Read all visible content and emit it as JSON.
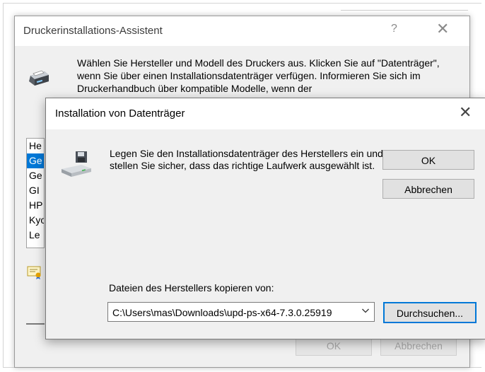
{
  "wizard": {
    "title": "Druckerinstallations-Assistent",
    "help_glyph": "?",
    "close_glyph": "✕",
    "description": "Wählen Sie Hersteller und Modell des Druckers aus. Klicken Sie auf \"Datenträger\", wenn Sie über einen Installationsdatenträger verfügen. Informieren Sie sich im Druckerhandbuch über kompatible Modelle, wenn der",
    "manufacturers": [
      "He",
      "Ge",
      "Ge",
      "GI",
      "HP",
      "Kyo",
      "Le"
    ],
    "selected_index": 1,
    "ok_label": "OK",
    "cancel_label": "Abbrechen"
  },
  "dialog": {
    "title": "Installation von Datenträger",
    "close_glyph": "✕",
    "message": "Legen Sie den Installationsdatenträger des Herstellers ein und stellen Sie sicher, dass das richtige Laufwerk ausgewählt ist.",
    "ok_label": "OK",
    "cancel_label": "Abbrechen",
    "copy_label": "Dateien des Herstellers kopieren von:",
    "path_value": "C:\\Users\\mas\\Downloads\\upd-ps-x64-7.3.0.25919",
    "browse_label": "Durchsuchen..."
  },
  "icons": {
    "wizard_icon": "printer-icon",
    "dialog_icon": "disk-drive-icon",
    "cert_icon": "certificate-icon",
    "combo_arrow": "chevron-down-icon"
  },
  "colors": {
    "selection": "#0078d7",
    "focus_border": "#0078d7",
    "dialog_bg": "#f0f0f0"
  }
}
